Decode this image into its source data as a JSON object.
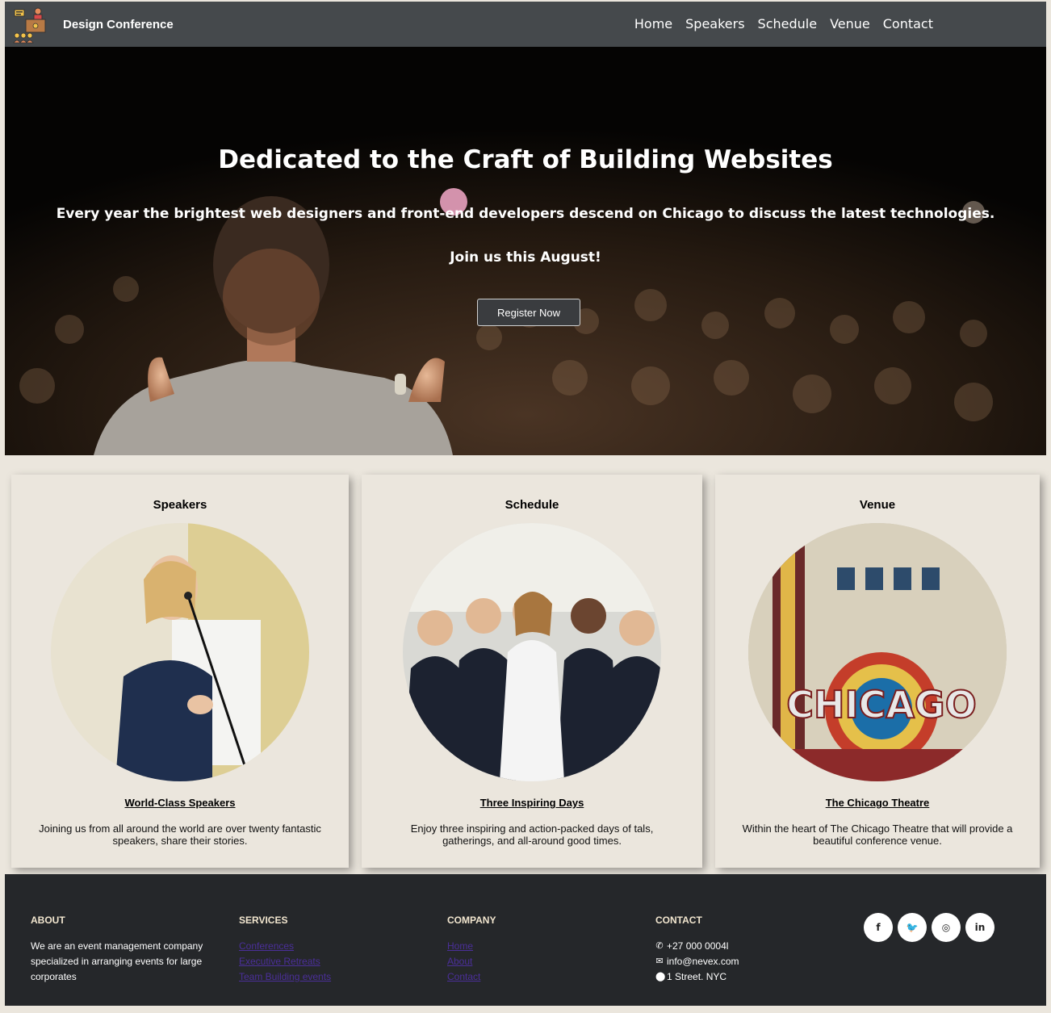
{
  "nav": {
    "brand": "Design Conference",
    "links": [
      "Home",
      "Speakers",
      "Schedule",
      "Venue",
      "Contact"
    ]
  },
  "hero": {
    "title": "Dedicated to the Craft of Building Websites",
    "subtitle": "Every year the brightest web designers and front-end developers descend on Chicago to discuss the latest technologies.",
    "join": "Join us this August!",
    "button": "Register Now"
  },
  "cards": [
    {
      "title": "Speakers",
      "heading": "World-Class Speakers",
      "text": "Joining us from all around the world are over twenty fantastic speakers, share their stories."
    },
    {
      "title": "Schedule",
      "heading": "Three Inspiring Days",
      "text": "Enjoy three inspiring and action-packed days of tals, gatherings, and all-around good times."
    },
    {
      "title": "Venue",
      "heading": "The Chicago Theatre",
      "text": "Within the heart of The Chicago Theatre that will provide a beautiful conference venue.",
      "sign_text": "CHICAGO"
    }
  ],
  "footer": {
    "about": {
      "heading": "ABOUT",
      "text": "We are an event management company specialized in arranging events for large corporates"
    },
    "services": {
      "heading": "SERVICES",
      "links": [
        "Conferences",
        "Executive Retreats",
        "Team Building events"
      ]
    },
    "company": {
      "heading": "COMPANY",
      "links": [
        "Home",
        "About",
        "Contact"
      ]
    },
    "contact": {
      "heading": "CONTACT",
      "phone": "+27 000 0004l",
      "email": "info@nevex.com",
      "address": "1 Street. NYC"
    },
    "socials": [
      {
        "icon": "facebook-icon",
        "glyph": "f"
      },
      {
        "icon": "twitter-icon",
        "glyph": "🐦"
      },
      {
        "icon": "dribbble-icon",
        "glyph": "◎"
      },
      {
        "icon": "linkedin-icon",
        "glyph": "in"
      }
    ]
  }
}
